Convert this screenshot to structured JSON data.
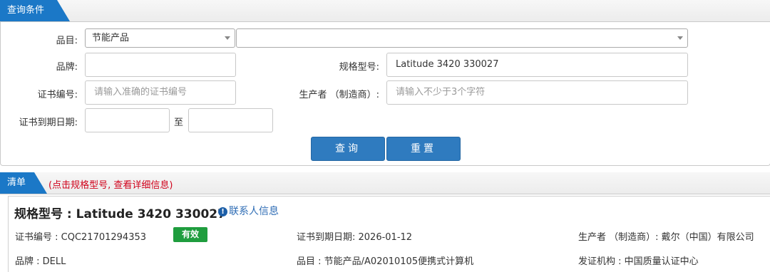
{
  "query": {
    "tab_label": "查询条件",
    "category_label": "品目:",
    "category_value": "节能产品",
    "subcategory_value": "",
    "brand_label": "品牌:",
    "brand_value": "",
    "model_label": "规格型号:",
    "model_value": "Latitude 3420 330027",
    "cert_no_label": "证书编号:",
    "cert_no_placeholder": "请输入准确的证书编号",
    "manufacturer_label": "生产者 （制造商）:",
    "manufacturer_placeholder": "请输入不少于3个字符",
    "expiry_label": "证书到期日期:",
    "expiry_from": "",
    "expiry_to_label": "至",
    "expiry_to": "",
    "search_button": "查询",
    "reset_button": "重置"
  },
  "list": {
    "tab_label": "清单",
    "note": "(点击规格型号, 查看详细信息)",
    "result": {
      "title": "规格型号 : Latitude 3420 330027",
      "contact_link": "联系人信息",
      "cert_no": "证书编号 : CQC21701294353",
      "status": "有效",
      "expiry": "证书到期日期: 2026-01-12",
      "manufacturer": "生产者 （制造商）: 戴尔（中国）有限公司",
      "brand": "品牌 : DELL",
      "category": "品目 : 节能产品/A02010105便携式计算机",
      "issuer": "发证机构 : 中国质量认证中心"
    }
  },
  "colors": {
    "accent": "#1b78c7",
    "button": "#2f7bbf",
    "valid_badge": "#1f9d3e",
    "note": "#d0021b"
  }
}
